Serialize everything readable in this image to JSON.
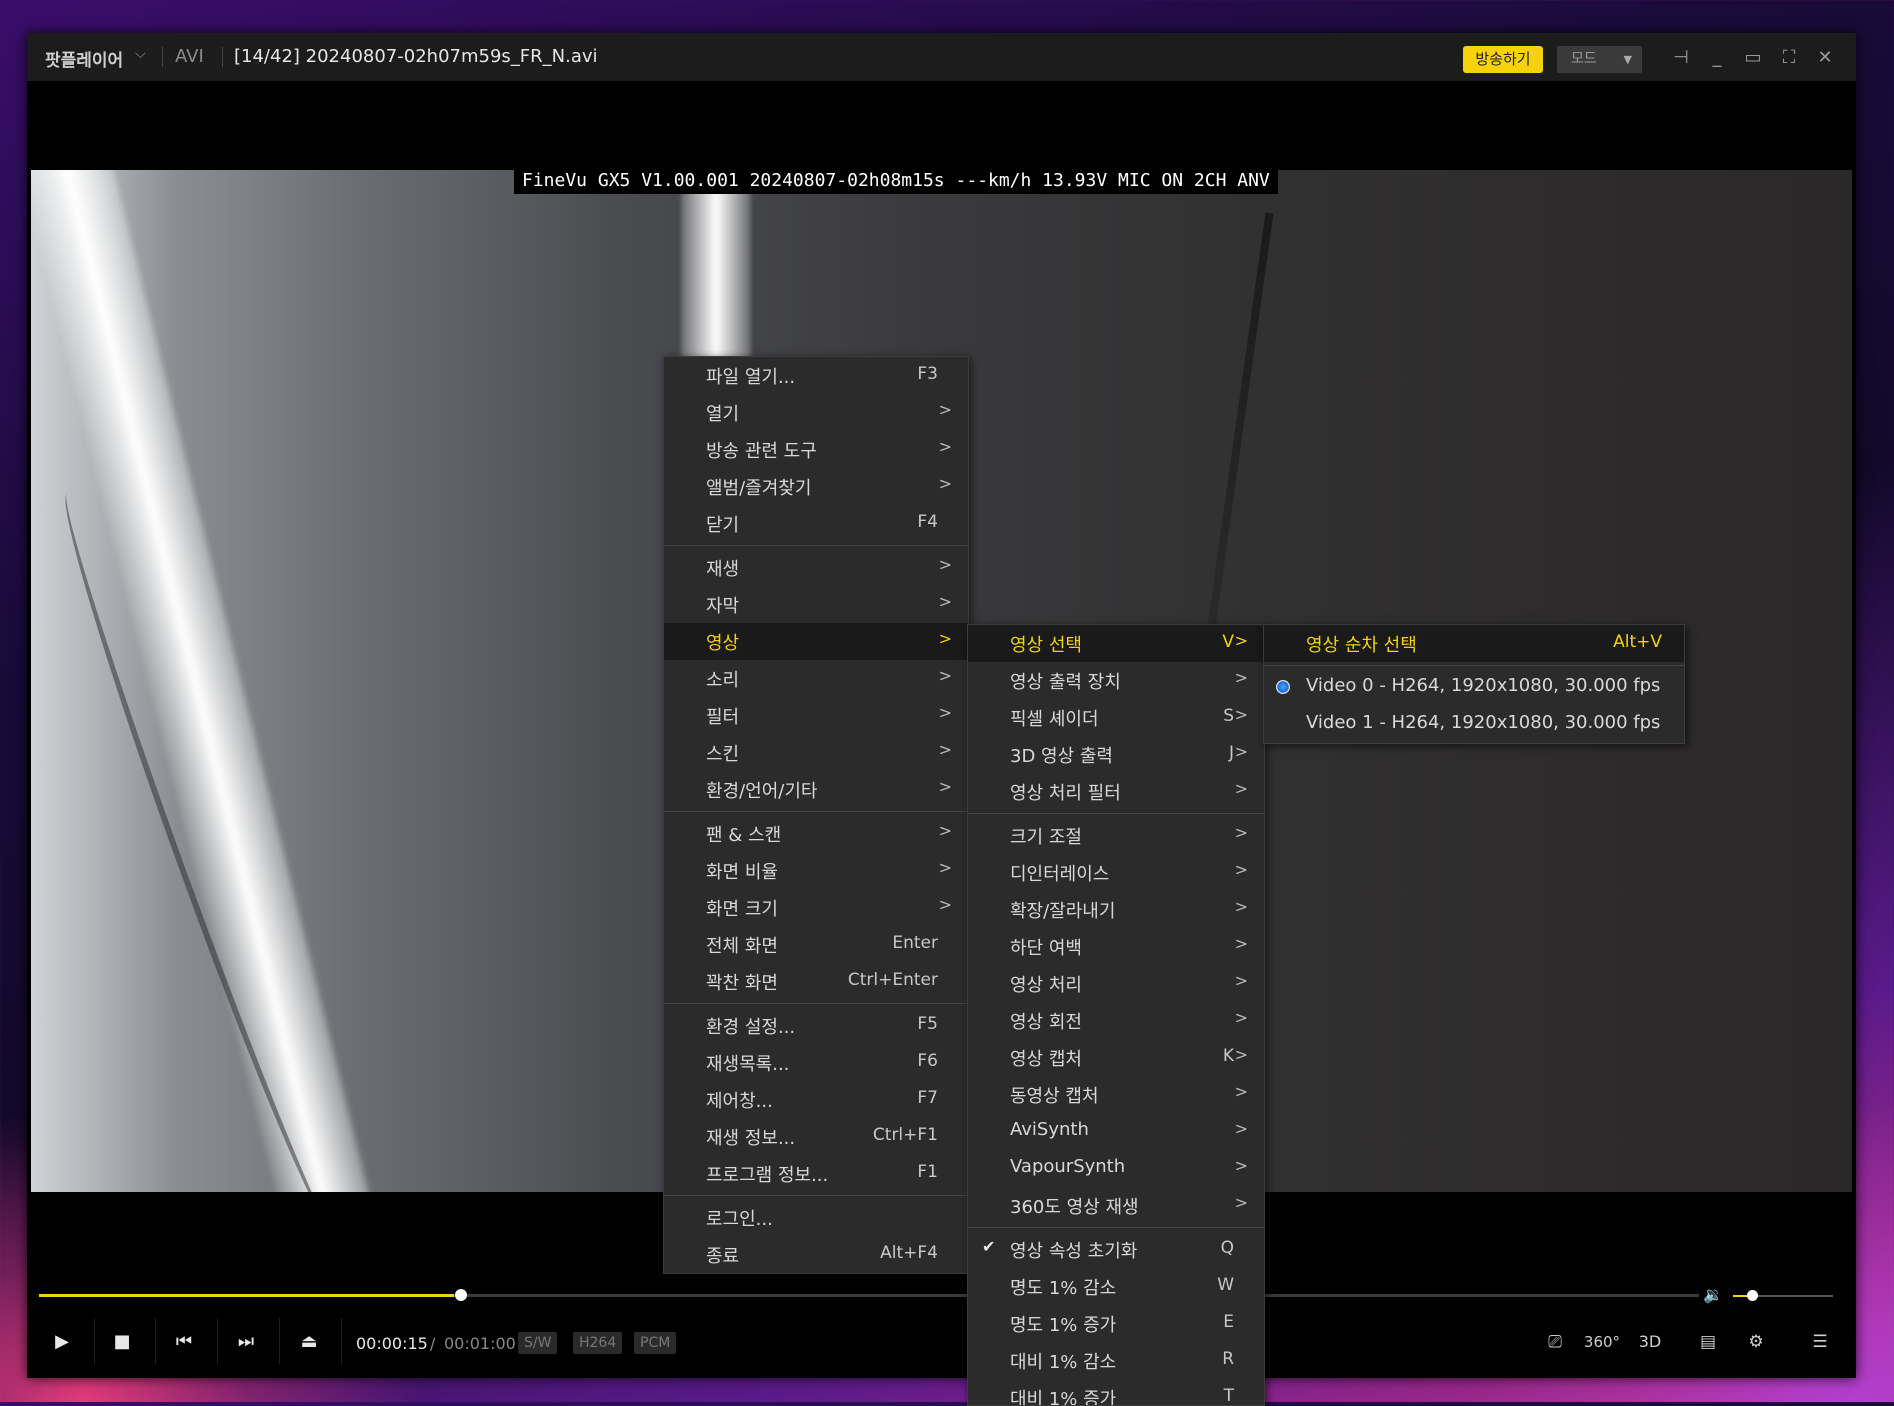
{
  "titlebar": {
    "app_name": "팟플레이어",
    "format": "AVI",
    "file_title": "[14/42] 20240807-02h07m59s_FR_N.avi",
    "broadcast_label": "방송하기",
    "mode_label": "모드"
  },
  "overlay": {
    "text": "FineVu GX5 V1.00.001 20240807-02h08m15s ---km/h 13.93V MIC ON  2CH ANV"
  },
  "playback": {
    "current_time": "00:00:15",
    "separator": "/",
    "total_time": "00:01:00",
    "progress_fraction": 0.25,
    "volume_fraction": 0.2,
    "tags": [
      "S/W",
      "H264",
      "PCM"
    ]
  },
  "main_menu": {
    "items": [
      {
        "label": "파일 열기...",
        "shortcut": "F3"
      },
      {
        "label": "열기",
        "arrow": ">"
      },
      {
        "label": "방송 관련 도구",
        "arrow": ">"
      },
      {
        "label": "앨범/즐겨찾기",
        "arrow": ">"
      },
      {
        "label": "닫기",
        "shortcut": "F4"
      },
      {
        "label": "재생",
        "arrow": ">"
      },
      {
        "label": "자막",
        "arrow": ">"
      },
      {
        "label": "영상",
        "arrow": ">"
      },
      {
        "label": "소리",
        "arrow": ">"
      },
      {
        "label": "필터",
        "arrow": ">"
      },
      {
        "label": "스킨",
        "arrow": ">"
      },
      {
        "label": "환경/언어/기타",
        "arrow": ">"
      },
      {
        "label": "팬 & 스캔",
        "arrow": ">"
      },
      {
        "label": "화면 비율",
        "arrow": ">"
      },
      {
        "label": "화면 크기",
        "arrow": ">"
      },
      {
        "label": "전체 화면",
        "shortcut": "Enter"
      },
      {
        "label": "꽉찬 화면",
        "shortcut": "Ctrl+Enter"
      },
      {
        "label": "환경 설정...",
        "shortcut": "F5"
      },
      {
        "label": "재생목록...",
        "shortcut": "F6"
      },
      {
        "label": "제어창...",
        "shortcut": "F7"
      },
      {
        "label": "재생 정보...",
        "shortcut": "Ctrl+F1"
      },
      {
        "label": "프로그램 정보...",
        "shortcut": "F1"
      },
      {
        "label": "로그인..."
      },
      {
        "label": "종료",
        "shortcut": "Alt+F4"
      }
    ]
  },
  "video_menu": {
    "items": [
      {
        "label": "영상 선택",
        "shortcut": "V",
        "arrow": ">"
      },
      {
        "label": "영상 출력 장치",
        "arrow": ">"
      },
      {
        "label": "픽셀 셰이더",
        "shortcut": "S",
        "arrow": ">"
      },
      {
        "label": "3D 영상 출력",
        "shortcut": "J",
        "arrow": ">"
      },
      {
        "label": "영상 처리 필터",
        "arrow": ">"
      },
      {
        "label": "크기 조절",
        "arrow": ">"
      },
      {
        "label": "디인터레이스",
        "arrow": ">"
      },
      {
        "label": "확장/잘라내기",
        "arrow": ">"
      },
      {
        "label": "하단 여백",
        "arrow": ">"
      },
      {
        "label": "영상 처리",
        "arrow": ">"
      },
      {
        "label": "영상 회전",
        "arrow": ">"
      },
      {
        "label": "영상 캡처",
        "shortcut": "K",
        "arrow": ">"
      },
      {
        "label": "동영상 캡처",
        "arrow": ">"
      },
      {
        "label": "AviSynth",
        "arrow": ">"
      },
      {
        "label": "VapourSynth",
        "arrow": ">"
      },
      {
        "label": "360도 영상 재생",
        "arrow": ">"
      },
      {
        "label": "영상 속성 초기화",
        "shortcut": "Q"
      },
      {
        "label": "명도 1% 감소",
        "shortcut": "W"
      },
      {
        "label": "명도 1% 증가",
        "shortcut": "E"
      },
      {
        "label": "대비 1% 감소",
        "shortcut": "R"
      },
      {
        "label": "대비 1% 증가",
        "shortcut": "T"
      }
    ]
  },
  "select_menu": {
    "items": [
      {
        "label": "영상 순차 선택",
        "shortcut": "Alt+V"
      },
      {
        "label": "Video 0 - H264, 1920x1080, 30.000 fps"
      },
      {
        "label": "Video 1 - H264, 1920x1080, 30.000 fps"
      }
    ]
  },
  "colors": {
    "accent": "#f5d20a",
    "menu_bg": "#2b2b2b",
    "titlebar_bg": "#1c1c1c"
  }
}
